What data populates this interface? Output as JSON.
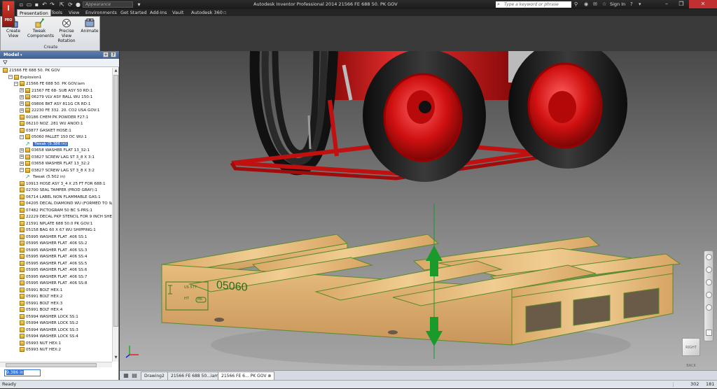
{
  "title_bar": {
    "logo_letter": "I",
    "logo_sub": "PRO",
    "appearance": "Appearance",
    "title": "Autodesk Inventor Professional 2014   21566 FE 688 50. PK GOV",
    "search_placeholder": "Type a keyword or phrase",
    "sign_in": "Sign In"
  },
  "ribbon": {
    "tabs": [
      "Presentation",
      "Tools",
      "View",
      "Environments",
      "Get Started",
      "Add-Ins",
      "Vault",
      "Autodesk 360"
    ],
    "active_tab": "Presentation",
    "buttons": [
      {
        "label": "Create View",
        "icon": "create-view-icon"
      },
      {
        "label": "Tweak Components",
        "icon": "tweak-components-icon"
      },
      {
        "label": "Precise View Rotation",
        "icon": "precise-view-rotation-icon"
      },
      {
        "label": "Animate",
        "icon": "animate-icon"
      }
    ],
    "panel_label": "Create"
  },
  "model_panel": {
    "title": "Model",
    "nodes": [
      {
        "label": "21566 FE 688 50. PK GOV",
        "level": 0,
        "expander": "",
        "icon": "presentation"
      },
      {
        "label": "Explosion1",
        "level": 1,
        "expander": "−",
        "icon": "explosion"
      },
      {
        "label": "21566 FE 688 50. PK GOV.iam",
        "level": 2,
        "expander": "−",
        "icon": "assembly"
      },
      {
        "label": "21567 FE 68- SUB ASY 50 RD:1",
        "level": 3,
        "expander": "+",
        "icon": "assembly"
      },
      {
        "label": "06279 VLV ASY BALL WU 150:1",
        "level": 3,
        "expander": "+",
        "icon": "assembly"
      },
      {
        "label": "09806 BKT ASY 811G CR RD:1",
        "level": 3,
        "expander": "+",
        "icon": "assembly"
      },
      {
        "label": "22230 FE 332. 20. CO2 USA GOV:1",
        "level": 3,
        "expander": "+",
        "icon": "assembly"
      },
      {
        "label": "00186 CHEM PK POWDER F27:1",
        "level": 3,
        "expander": "",
        "icon": "part"
      },
      {
        "label": "06210 NOZ .281 WU ANOD:1",
        "level": 3,
        "expander": "",
        "icon": "part"
      },
      {
        "label": "03877 GASKET HOSE:1",
        "level": 3,
        "expander": "",
        "icon": "part"
      },
      {
        "label": "05060 PALLET 150 DC WU:1",
        "level": 3,
        "expander": "−",
        "icon": "part"
      },
      {
        "label": "Tweak (9.386 in)",
        "level": 4,
        "expander": "",
        "icon": "tweak",
        "selected": true
      },
      {
        "label": "03658 WASHER FLAT 13_32:1",
        "level": 3,
        "expander": "+",
        "icon": "part"
      },
      {
        "label": "03827 SCREW LAG ST 3_8 X 3:1",
        "level": 3,
        "expander": "+",
        "icon": "part"
      },
      {
        "label": "03658 WASHER FLAT 13_32:2",
        "level": 3,
        "expander": "+",
        "icon": "part"
      },
      {
        "label": "03827 SCREW LAG ST 3_8 X 3:2",
        "level": 3,
        "expander": "−",
        "icon": "part"
      },
      {
        "label": "Tweak (5.502 in)",
        "level": 4,
        "expander": "",
        "icon": "tweak"
      },
      {
        "label": "10913 HOSE ASY 3_4 X 25 FT FOR 688:1",
        "level": 3,
        "expander": "",
        "icon": "assembly"
      },
      {
        "label": "02700 SEAL TAMPER (PROD GRAY):1",
        "level": 3,
        "expander": "",
        "icon": "part"
      },
      {
        "label": "06714 LABEL NON FLAMMABLE GAS:1",
        "level": 3,
        "expander": "",
        "icon": "part"
      },
      {
        "label": "04205 DECAL DIAMOND WU (FORMED TO 9/",
        "level": 3,
        "expander": "",
        "icon": "part"
      },
      {
        "label": "07482 PICTOGRAM 50 BC S-PRS:1",
        "level": 3,
        "expander": "",
        "icon": "part"
      },
      {
        "label": "22229 DECAL PKP STENCIL FOR 9 INCH SHE",
        "level": 3,
        "expander": "",
        "icon": "part"
      },
      {
        "label": "21591 NPLATE 688 50.0 PK GOV:1",
        "level": 3,
        "expander": "",
        "icon": "part"
      },
      {
        "label": "05158 BAG 60 X 67 WU SHIPPING:1",
        "level": 3,
        "expander": "",
        "icon": "part"
      },
      {
        "label": "05995 WASHER FLAT .406 SS:1",
        "level": 3,
        "expander": "",
        "icon": "part"
      },
      {
        "label": "05995 WASHER FLAT .406 SS:2",
        "level": 3,
        "expander": "",
        "icon": "part"
      },
      {
        "label": "05995 WASHER FLAT .406 SS:3",
        "level": 3,
        "expander": "",
        "icon": "part"
      },
      {
        "label": "05995 WASHER FLAT .406 SS:4",
        "level": 3,
        "expander": "",
        "icon": "part"
      },
      {
        "label": "05995 WASHER FLAT .406 SS:5",
        "level": 3,
        "expander": "",
        "icon": "part"
      },
      {
        "label": "05995 WASHER FLAT .406 SS:6",
        "level": 3,
        "expander": "",
        "icon": "part"
      },
      {
        "label": "05995 WASHER FLAT .406 SS:7",
        "level": 3,
        "expander": "",
        "icon": "part"
      },
      {
        "label": "05995 WASHER FLAT .406 SS:8",
        "level": 3,
        "expander": "",
        "icon": "part"
      },
      {
        "label": "05991 BOLT HEX:1",
        "level": 3,
        "expander": "",
        "icon": "part"
      },
      {
        "label": "05991 BOLT HEX:2",
        "level": 3,
        "expander": "",
        "icon": "part"
      },
      {
        "label": "05991 BOLT HEX:3",
        "level": 3,
        "expander": "",
        "icon": "part"
      },
      {
        "label": "05991 BOLT HEX:4",
        "level": 3,
        "expander": "",
        "icon": "part"
      },
      {
        "label": "05994 WASHER LOCK SS:1",
        "level": 3,
        "expander": "",
        "icon": "part"
      },
      {
        "label": "05994 WASHER LOCK SS:2",
        "level": 3,
        "expander": "",
        "icon": "part"
      },
      {
        "label": "05994 WASHER LOCK SS:3",
        "level": 3,
        "expander": "",
        "icon": "part"
      },
      {
        "label": "05994 WASHER LOCK SS:4",
        "level": 3,
        "expander": "",
        "icon": "part"
      },
      {
        "label": "05993 NUT HEX:1",
        "level": 3,
        "expander": "",
        "icon": "part"
      },
      {
        "label": "05993 NUT HEX:2",
        "level": 3,
        "expander": "",
        "icon": "part"
      }
    ],
    "tweak_value": "9.386 in"
  },
  "viewport": {
    "pallet_stamp": "05060",
    "pallet_cert_top": "US 577",
    "pallet_cert_mid": "HT",
    "pallet_cert_tag": "PRL",
    "viewcube_left": "RIGHT",
    "viewcube_right": "BACK"
  },
  "doc_tabs": {
    "tabs": [
      "Drawing2",
      "21566 FE 688 50...iam",
      "21566 FE 6... PK GOV"
    ],
    "active": "21566 FE 6... PK GOV"
  },
  "status": {
    "text": "Ready",
    "count1": "302",
    "count2": "181"
  },
  "colors": {
    "accent": "#3874d8",
    "cart_red": "#d81a1a",
    "arrow_green": "#1a9a2a",
    "wood": "#e9bf7c"
  }
}
